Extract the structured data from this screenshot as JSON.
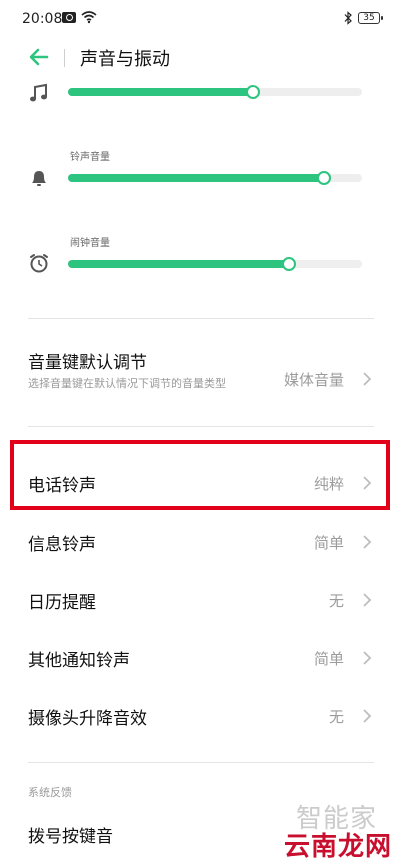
{
  "status_bar": {
    "time": "20:08",
    "battery": "35"
  },
  "header": {
    "title": "声音与振动"
  },
  "volume": {
    "media": {
      "label": "",
      "icon": "music-note-icon",
      "level": 0.63
    },
    "ringtone": {
      "label": "铃声音量",
      "icon": "bell-icon",
      "level": 0.87
    },
    "alarm": {
      "label": "闹钟音量",
      "icon": "alarm-clock-icon",
      "level": 0.75
    }
  },
  "settings": {
    "volume_key": {
      "label": "音量键默认调节",
      "description": "选择音量键在默认情况下调节的音量类型",
      "value": "媒体音量"
    },
    "phone_ringtone": {
      "label": "电话铃声",
      "value": "纯粹"
    },
    "message_ringtone": {
      "label": "信息铃声",
      "value": "简单"
    },
    "calendar_reminder": {
      "label": "日历提醒",
      "value": "无"
    },
    "other_notification": {
      "label": "其他通知铃声",
      "value": "简单"
    },
    "camera_lift": {
      "label": "摄像头升降音效",
      "value": "无"
    }
  },
  "feedback": {
    "caption": "系统反馈",
    "dial_pad": {
      "label": "拨号按键音"
    }
  },
  "watermark": {
    "top": "智能家",
    "bottom": "云南龙网"
  },
  "colors": {
    "accent": "#2cc47e",
    "highlight": "#e3001b"
  }
}
